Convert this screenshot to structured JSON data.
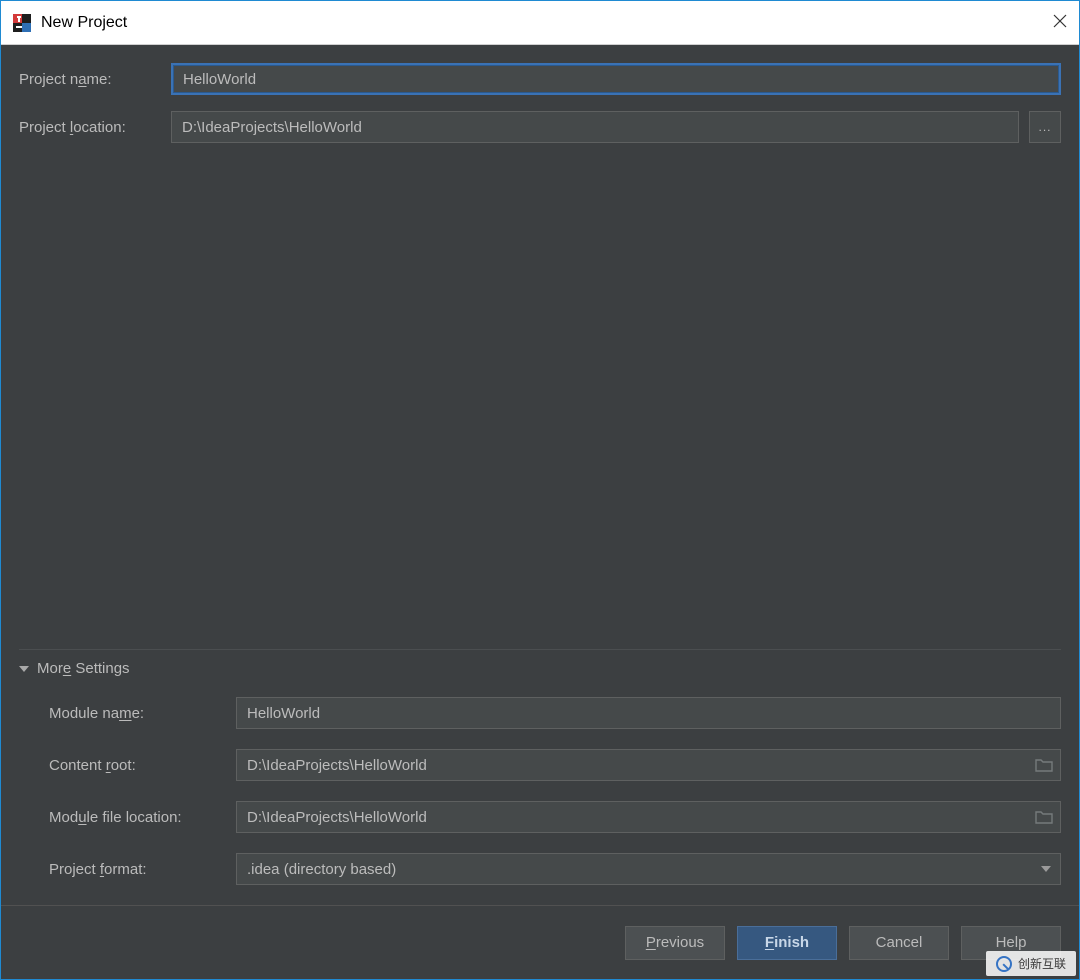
{
  "titlebar": {
    "title": "New Project"
  },
  "labels": {
    "project_name_pre": "Project n",
    "project_name_mn": "a",
    "project_name_post": "me:",
    "project_location_pre": "Project ",
    "project_location_mn": "l",
    "project_location_post": "ocation:",
    "more_settings_pre": "Mor",
    "more_settings_mn": "e",
    "more_settings_post": " Settings",
    "module_name_pre": "Module na",
    "module_name_mn": "m",
    "module_name_post": "e:",
    "content_root_pre": "Content ",
    "content_root_mn": "r",
    "content_root_post": "oot:",
    "module_file_location_pre": "Mod",
    "module_file_location_mn": "u",
    "module_file_location_post": "le file location:",
    "project_format_pre": "Project ",
    "project_format_mn": "f",
    "project_format_post": "ormat:"
  },
  "fields": {
    "project_name": "HelloWorld",
    "project_location": "D:\\IdeaProjects\\HelloWorld",
    "module_name": "HelloWorld",
    "content_root": "D:\\IdeaProjects\\HelloWorld",
    "module_file_location": "D:\\IdeaProjects\\HelloWorld",
    "project_format": ".idea (directory based)",
    "browse": "..."
  },
  "footer": {
    "previous_mn": "P",
    "previous_post": "revious",
    "finish_mn": "F",
    "finish_post": "inish",
    "cancel": "Cancel",
    "help": "Help"
  },
  "watermark": {
    "text": "创新互联"
  }
}
